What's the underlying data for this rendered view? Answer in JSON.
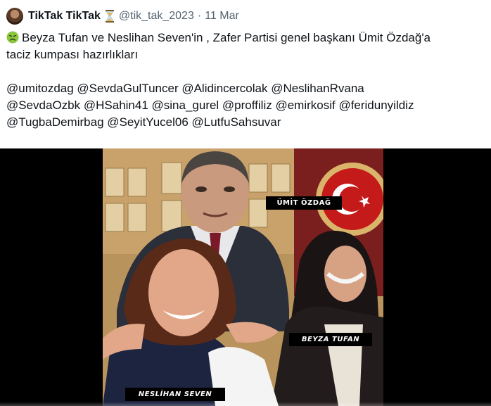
{
  "tweet": {
    "author_name": "TikTak TikTak",
    "author_badge_icon": "hourglass-icon",
    "handle": "@tik_tak_2023",
    "separator": "·",
    "date": "11 Mar",
    "emoji_icon": "nauseated-face-icon",
    "text_line1": "Beyza Tufan ve Neslihan Seven'in , Zafer Partisi genel başkanı Ümit Özdağ'a",
    "text_line2": "taciz kumpası hazırlıkları",
    "mentions_line1": "@umitozdag @SevdaGulTuncer @Alidincercolak @NeslihanRvana",
    "mentions_line2": "@SevdaOzbk @HSahin41 @sina_gurel @proffiliz  @emirkosif @feridunyildiz",
    "mentions_line3": "@TugbaDemirbag @SeyitYucel06 @LutfuSahsuvar"
  },
  "media": {
    "labels": {
      "top": "ÜMİT ÖZDAĞ",
      "right": "BEYZA TUFAN",
      "left": "NESLİHAN SEVEN"
    },
    "colors": {
      "background": "#000000",
      "parliament_wall": "#c8a26a",
      "flag_red": "#c41a1a"
    }
  }
}
